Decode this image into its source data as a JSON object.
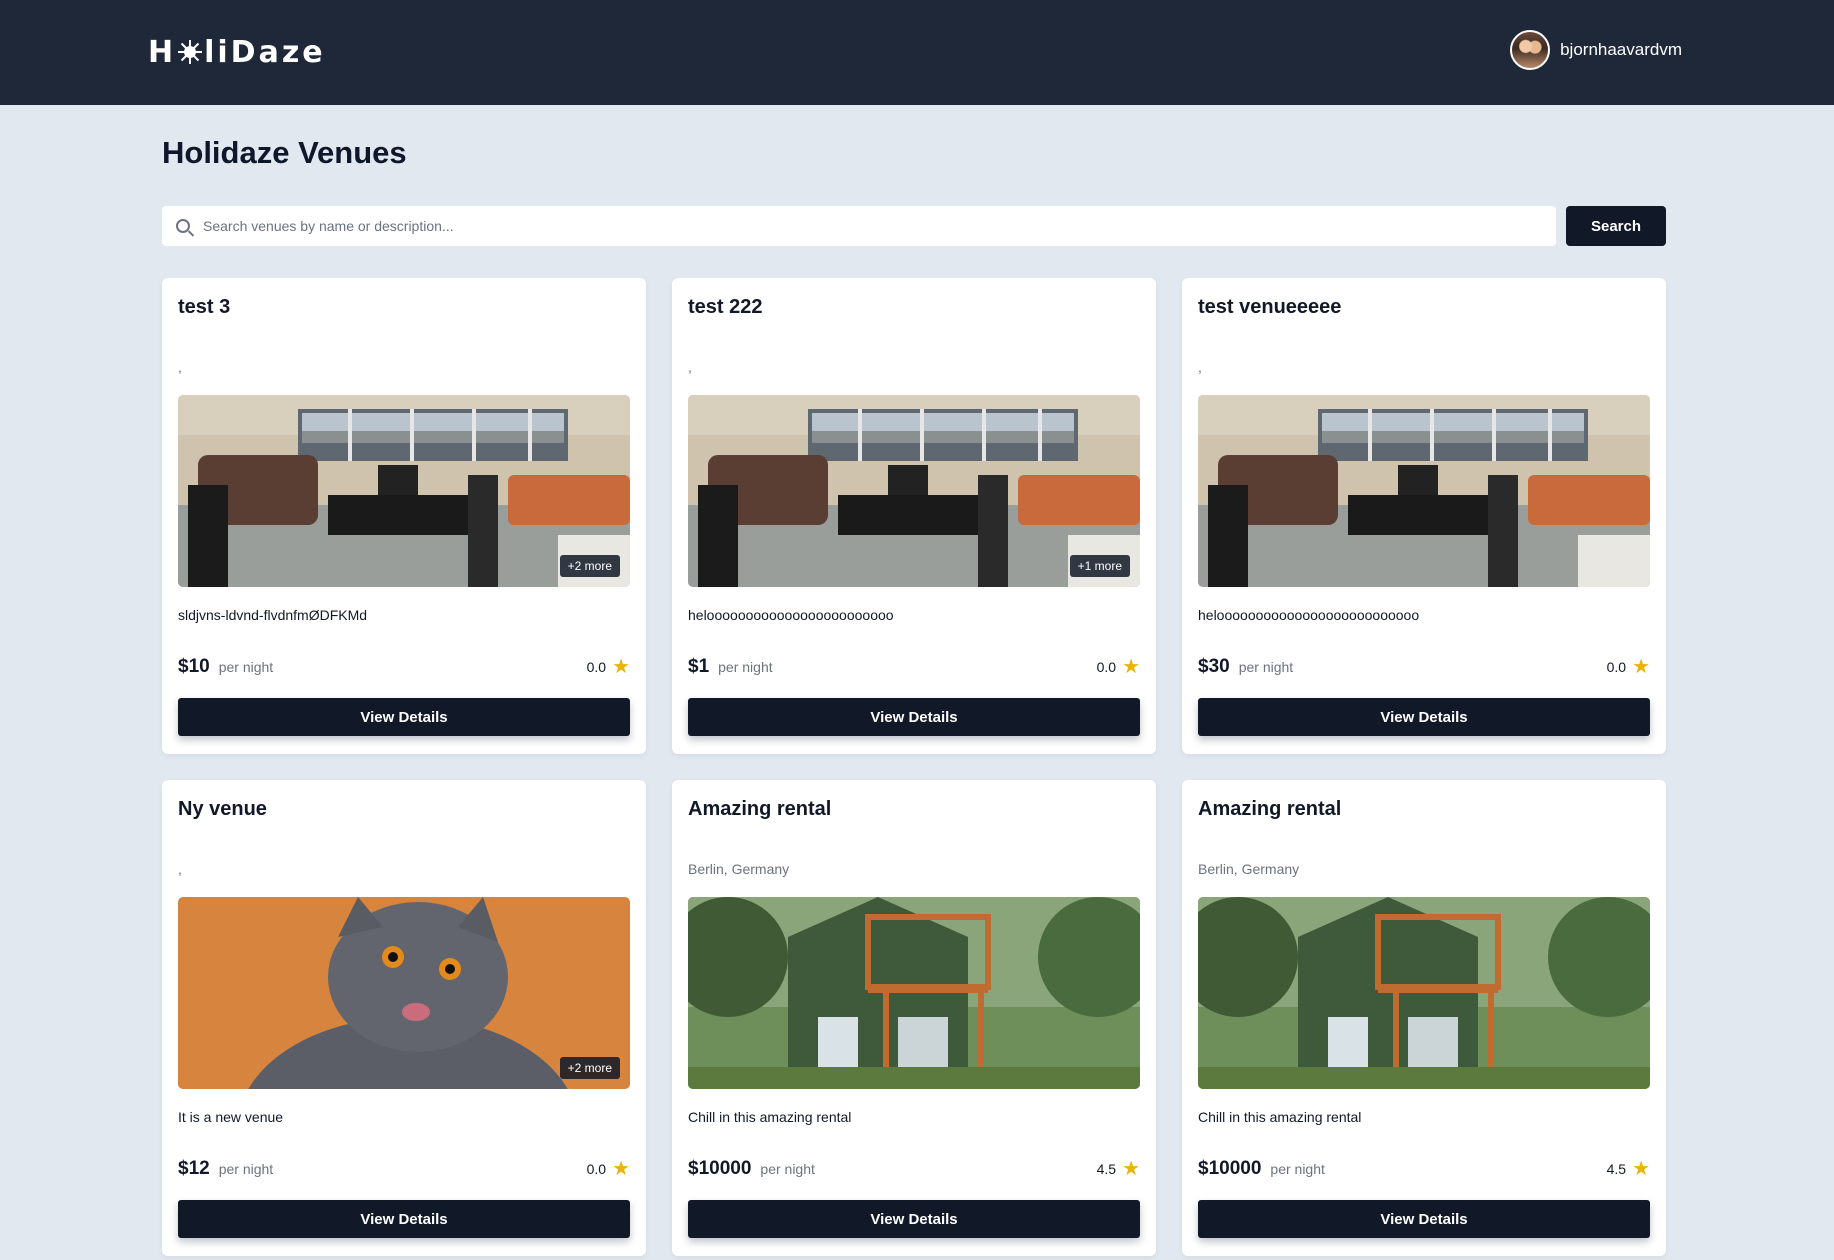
{
  "header": {
    "logo_text": "HoliDaze",
    "logo_left": "H",
    "logo_right": "liDaze",
    "username": "bjornhaavardvm"
  },
  "page": {
    "title": "Holidaze Venues"
  },
  "search": {
    "placeholder": "Search venues by name or description...",
    "button_label": "Search"
  },
  "venues": [
    {
      "name": "test 3",
      "location": ",",
      "image": "room-photo",
      "more_badge": "+2 more",
      "description": "sldjvns-ldvnd-flvdnfmØDFKMd",
      "price": "$10",
      "per_night": "per night",
      "rating": "0.0",
      "button_label": "View Details"
    },
    {
      "name": "test 222",
      "location": ",",
      "image": "room-photo",
      "more_badge": "+1 more",
      "description": "heloooooooooooooooooooooooo",
      "price": "$1",
      "per_night": "per night",
      "rating": "0.0",
      "button_label": "View Details"
    },
    {
      "name": "test venueeeee",
      "location": ",",
      "image": "room-photo",
      "more_badge": "",
      "description": "heloooooooooooooooooooooooooo",
      "price": "$30",
      "per_night": "per night",
      "rating": "0.0",
      "button_label": "View Details"
    },
    {
      "name": "Ny venue",
      "location": ",",
      "image": "cat-photo",
      "more_badge": "+2 more",
      "description": "It is a new venue",
      "price": "$12",
      "per_night": "per night",
      "rating": "0.0",
      "button_label": "View Details"
    },
    {
      "name": "Amazing rental",
      "location": "Berlin, Germany",
      "image": "house-photo",
      "more_badge": "",
      "description": "Chill in this amazing rental",
      "price": "$10000",
      "per_night": "per night",
      "rating": "4.5",
      "button_label": "View Details"
    },
    {
      "name": "Amazing rental",
      "location": "Berlin, Germany",
      "image": "house-photo",
      "more_badge": "",
      "description": "Chill in this amazing rental",
      "price": "$10000",
      "per_night": "per night",
      "rating": "4.5",
      "button_label": "View Details"
    }
  ],
  "colors": {
    "header_bg": "#1e2838",
    "page_bg": "#e2e8f0",
    "button_bg": "#111827",
    "star": "#eab308"
  }
}
